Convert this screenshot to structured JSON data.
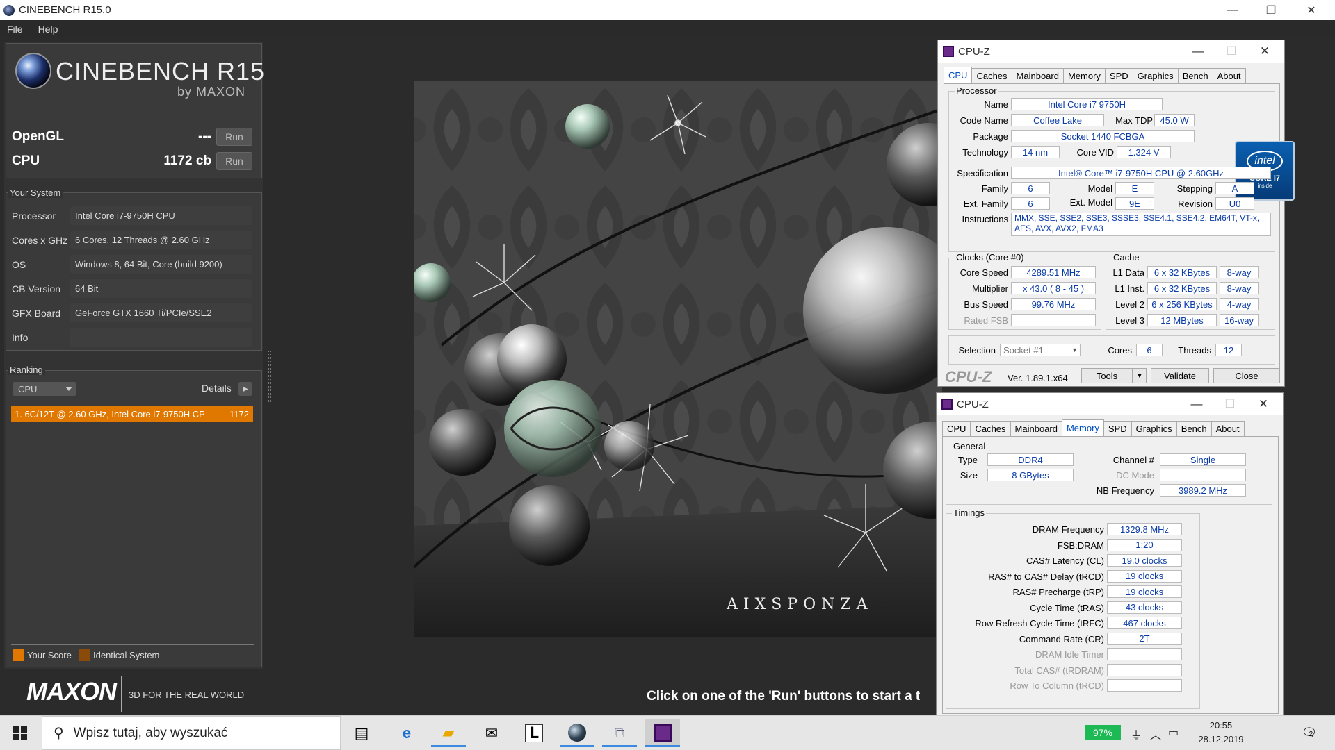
{
  "window": {
    "title": "CINEBENCH R15.0",
    "minimize": "—",
    "restore": "❐",
    "close": "✕"
  },
  "menu": {
    "file": "File",
    "help": "Help"
  },
  "logo": {
    "title": "CINEBENCH R15",
    "sub": "by MAXON"
  },
  "bench": {
    "opengl_label": "OpenGL",
    "opengl_value": "---",
    "opengl_run": "Run",
    "cpu_label": "CPU",
    "cpu_value": "1172 cb",
    "cpu_run": "Run"
  },
  "system": {
    "title": "Your System",
    "rows": [
      {
        "label": "Processor",
        "value": "Intel Core i7-9750H CPU"
      },
      {
        "label": "Cores x GHz",
        "value": "6 Cores, 12 Threads @ 2.60 GHz"
      },
      {
        "label": "OS",
        "value": "Windows 8, 64 Bit, Core (build 9200)"
      },
      {
        "label": "CB Version",
        "value": "64 Bit"
      },
      {
        "label": "GFX Board",
        "value": "GeForce GTX 1660 Ti/PCIe/SSE2"
      },
      {
        "label": "Info",
        "value": ""
      }
    ]
  },
  "ranking": {
    "title": "Ranking",
    "dropdown": "CPU",
    "details": "Details",
    "row_text": "1. 6C/12T @ 2.60 GHz, Intel Core i7-9750H CP",
    "row_score": "1172",
    "legend_your": "Your Score",
    "legend_identical": "Identical System",
    "your_color": "#e07800",
    "identical_color": "#8a4a0a"
  },
  "footer": {
    "maxon": "MAXON",
    "tagline": "3D FOR THE REAL WORLD",
    "hint": "Click on one of the 'Run' buttons to start a t"
  },
  "render": {
    "watermark": "AIXSPONZA"
  },
  "cpuz1": {
    "title": "CPU-Z",
    "tabs": [
      "CPU",
      "Caches",
      "Mainboard",
      "Memory",
      "SPD",
      "Graphics",
      "Bench",
      "About"
    ],
    "active_tab": "CPU",
    "processor_group": "Processor",
    "name_l": "Name",
    "name": "Intel Core i7 9750H",
    "code_l": "Code Name",
    "code": "Coffee Lake",
    "tdp_l": "Max TDP",
    "tdp": "45.0 W",
    "pkg_l": "Package",
    "pkg": "Socket 1440 FCBGA",
    "tech_l": "Technology",
    "tech": "14 nm",
    "vid_l": "Core VID",
    "vid": "1.324 V",
    "spec_l": "Specification",
    "spec": "Intel® Core™ i7-9750H CPU @ 2.60GHz",
    "fam_l": "Family",
    "fam": "6",
    "model_l": "Model",
    "model": "E",
    "step_l": "Stepping",
    "step": "A",
    "efam_l": "Ext. Family",
    "efam": "6",
    "emodel_l": "Ext. Model",
    "emodel": "9E",
    "rev_l": "Revision",
    "rev": "U0",
    "instr_l": "Instructions",
    "instr": "MMX, SSE, SSE2, SSE3, SSSE3, SSE4.1, SSE4.2, EM64T, VT-x, AES, AVX, AVX2, FMA3",
    "intel_top": "intel",
    "intel_core": "CORE i7",
    "intel_inside": "inside",
    "clocks_group": "Clocks (Core #0)",
    "cs_l": "Core Speed",
    "cs": "4289.51 MHz",
    "mul_l": "Multiplier",
    "mul": "x 43.0 ( 8 - 45 )",
    "bus_l": "Bus Speed",
    "bus": "99.76 MHz",
    "fsb_l": "Rated FSB",
    "fsb": "",
    "cache_group": "Cache",
    "l1d_l": "L1 Data",
    "l1d": "6 x 32 KBytes",
    "l1d_w": "8-way",
    "l1i_l": "L1 Inst.",
    "l1i": "6 x 32 KBytes",
    "l1i_w": "8-way",
    "l2_l": "Level 2",
    "l2": "6 x 256 KBytes",
    "l2_w": "4-way",
    "l3_l": "Level 3",
    "l3": "12 MBytes",
    "l3_w": "16-way",
    "sel_l": "Selection",
    "sel": "Socket #1",
    "cores_l": "Cores",
    "cores": "6",
    "threads_l": "Threads",
    "threads": "12",
    "brand": "CPU-Z",
    "ver": "Ver. 1.89.1.x64",
    "tools": "Tools",
    "validate": "Validate",
    "close": "Close"
  },
  "cpuz2": {
    "title": "CPU-Z",
    "tabs": [
      "CPU",
      "Caches",
      "Mainboard",
      "Memory",
      "SPD",
      "Graphics",
      "Bench",
      "About"
    ],
    "active_tab": "Memory",
    "general_group": "General",
    "type_l": "Type",
    "type": "DDR4",
    "chan_l": "Channel #",
    "chan": "Single",
    "size_l": "Size",
    "size": "8 GBytes",
    "dc_l": "DC Mode",
    "dc": "",
    "nb_l": "NB Frequency",
    "nb": "3989.2 MHz",
    "timings_group": "Timings",
    "timings": [
      {
        "label": "DRAM Frequency",
        "value": "1329.8 MHz",
        "dis": false
      },
      {
        "label": "FSB:DRAM",
        "value": "1:20",
        "dis": false
      },
      {
        "label": "CAS# Latency (CL)",
        "value": "19.0 clocks",
        "dis": false
      },
      {
        "label": "RAS# to CAS# Delay (tRCD)",
        "value": "19 clocks",
        "dis": false
      },
      {
        "label": "RAS# Precharge (tRP)",
        "value": "19 clocks",
        "dis": false
      },
      {
        "label": "Cycle Time (tRAS)",
        "value": "43 clocks",
        "dis": false
      },
      {
        "label": "Row Refresh Cycle Time (tRFC)",
        "value": "467 clocks",
        "dis": false
      },
      {
        "label": "Command Rate (CR)",
        "value": "2T",
        "dis": false
      },
      {
        "label": "DRAM Idle Timer",
        "value": "",
        "dis": true
      },
      {
        "label": "Total CAS# (tRDRAM)",
        "value": "",
        "dis": true
      },
      {
        "label": "Row To Column (tRCD)",
        "value": "",
        "dis": true
      }
    ]
  },
  "taskbar": {
    "search_placeholder": "Wpisz tutaj, aby wyszukać",
    "battery": "97%",
    "time": "20:55",
    "date": "28.12.2019",
    "notifications": "2"
  }
}
